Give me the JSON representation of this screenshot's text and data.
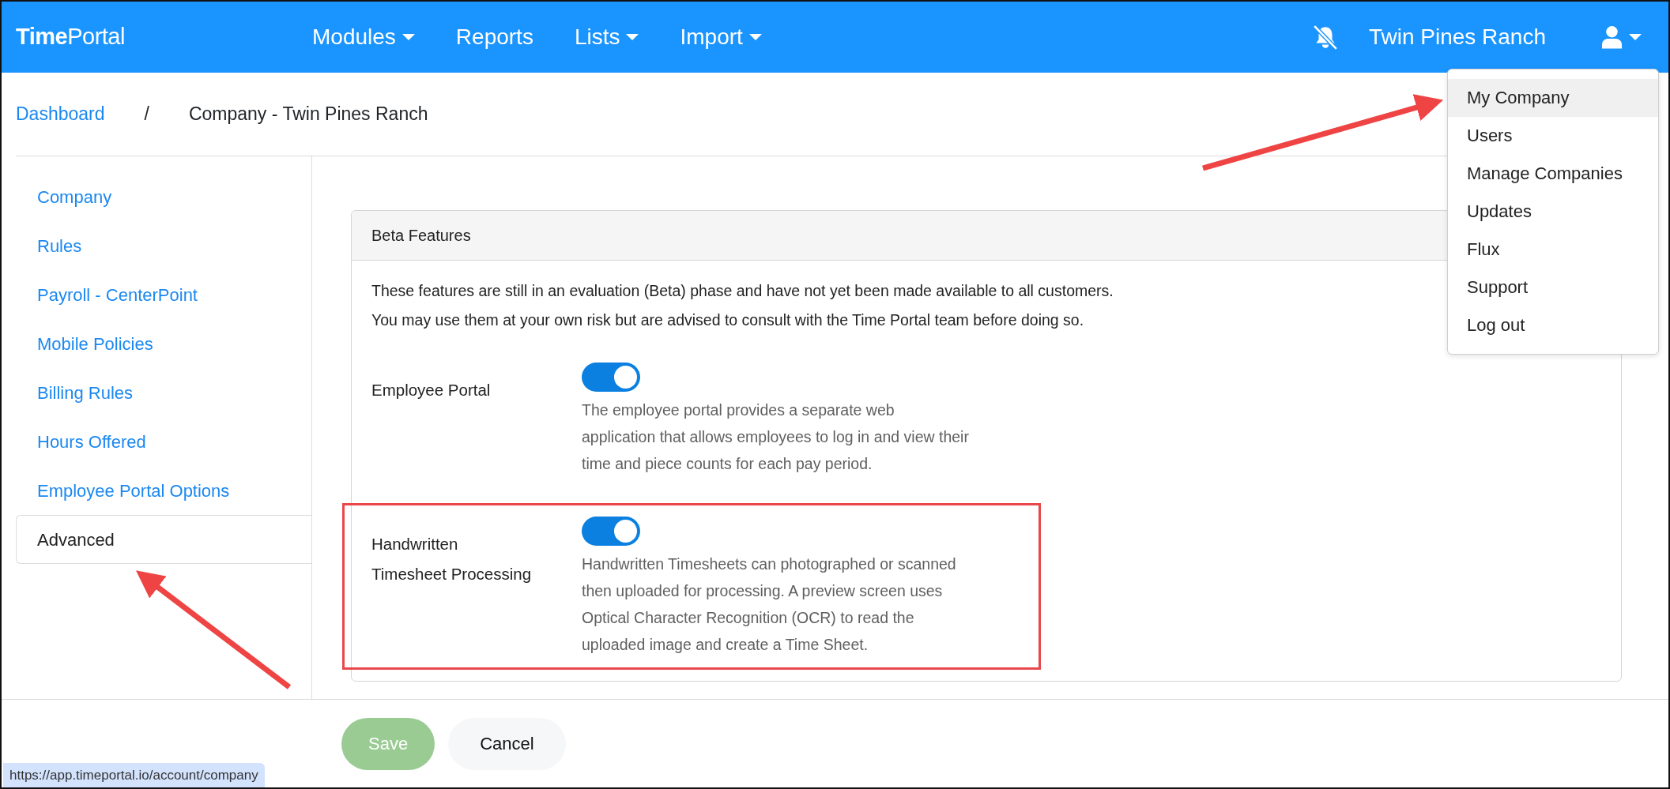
{
  "navbar": {
    "brand": {
      "bold": "Time",
      "light": "Portal"
    },
    "menu": [
      {
        "label": "Modules",
        "dropdown": true
      },
      {
        "label": "Reports",
        "dropdown": false
      },
      {
        "label": "Lists",
        "dropdown": true
      },
      {
        "label": "Import",
        "dropdown": true
      }
    ],
    "notifications_muted": true,
    "company": "Twin Pines Ranch",
    "user_menu": {
      "expanded": true,
      "items": [
        {
          "label": "My Company",
          "selected": true,
          "annotated": true
        },
        {
          "label": "Users",
          "selected": false,
          "annotated": false
        },
        {
          "label": "Manage Companies",
          "selected": false,
          "annotated": false
        },
        {
          "label": "Updates",
          "selected": false,
          "annotated": false
        },
        {
          "label": "Flux",
          "selected": false,
          "annotated": false
        },
        {
          "label": "Support",
          "selected": false,
          "annotated": false
        },
        {
          "label": "Log out",
          "selected": false,
          "annotated": false
        }
      ]
    }
  },
  "breadcrumb": [
    {
      "label": "Dashboard",
      "kind": "link"
    },
    {
      "label": "/",
      "kind": "separator"
    },
    {
      "label": "Company - Twin Pines Ranch",
      "kind": "current"
    }
  ],
  "sidebar": {
    "items": [
      {
        "label": "Company",
        "selected": false,
        "annotated": false
      },
      {
        "label": "Rules",
        "selected": false,
        "annotated": false
      },
      {
        "label": "Payroll - CenterPoint",
        "selected": false,
        "annotated": false
      },
      {
        "label": "Mobile Policies",
        "selected": false,
        "annotated": false
      },
      {
        "label": "Billing Rules",
        "selected": false,
        "annotated": false
      },
      {
        "label": "Hours Offered",
        "selected": false,
        "annotated": false
      },
      {
        "label": "Employee Portal Options",
        "selected": false,
        "annotated": false
      },
      {
        "label": "Advanced",
        "selected": true,
        "annotated": true
      }
    ]
  },
  "card": {
    "title": "Beta Features",
    "intro": [
      "These features are still in an evaluation (Beta) phase and have not yet been made available to all customers.",
      "You may use them at your own risk but are advised to consult with the Time Portal team before doing so."
    ],
    "features": [
      {
        "label": "Employee Portal",
        "on": true,
        "highlighted": false,
        "description": "The employee portal provides a separate web application that allows employees to log in and view their time and piece counts for each pay period."
      },
      {
        "label": "Handwritten Timesheet Processing",
        "on": true,
        "highlighted": true,
        "description": "Handwritten Timesheets can photographed or scanned then uploaded for processing. A preview screen uses Optical Character Recognition (OCR) to read the uploaded image and create a Time Sheet."
      }
    ]
  },
  "footer": {
    "buttons": [
      {
        "label": "Save",
        "kind": "primary",
        "disabled": true
      },
      {
        "label": "Cancel",
        "kind": "secondary",
        "disabled": false
      }
    ]
  },
  "status_bar": {
    "url": "https://app.timeportal.io/account/company"
  }
}
